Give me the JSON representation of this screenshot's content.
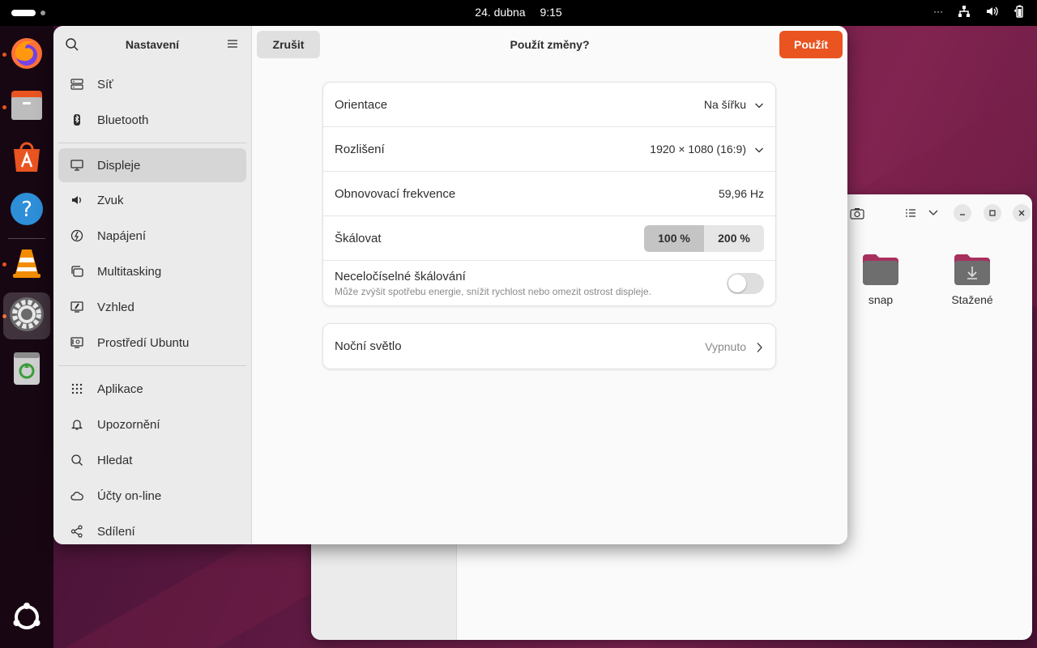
{
  "topbar": {
    "date": "24. dubna",
    "time": "9:15",
    "overflow": "···"
  },
  "dock": {
    "items": [
      "firefox-icon",
      "files-icon",
      "app-center-icon",
      "help-icon",
      "vlc-icon",
      "settings-icon",
      "trash-icon",
      "ubuntu-logo-icon"
    ]
  },
  "files": {
    "folders": [
      {
        "label": "snap"
      },
      {
        "label": "Stažené"
      }
    ]
  },
  "settings": {
    "sidebar": {
      "title": "Nastavení",
      "items": [
        {
          "label": "Síť",
          "icon": "network-icon"
        },
        {
          "label": "Bluetooth",
          "icon": "bluetooth-icon"
        },
        {
          "label": "Displeje",
          "icon": "display-icon"
        },
        {
          "label": "Zvuk",
          "icon": "sound-icon"
        },
        {
          "label": "Napájení",
          "icon": "power-icon"
        },
        {
          "label": "Multitasking",
          "icon": "multitasking-icon"
        },
        {
          "label": "Vzhled",
          "icon": "appearance-icon"
        },
        {
          "label": "Prostředí Ubuntu",
          "icon": "ubuntu-desktop-icon"
        },
        {
          "label": "Aplikace",
          "icon": "apps-icon"
        },
        {
          "label": "Upozornění",
          "icon": "notifications-icon"
        },
        {
          "label": "Hledat",
          "icon": "search-icon"
        },
        {
          "label": "Účty on-line",
          "icon": "cloud-icon"
        },
        {
          "label": "Sdílení",
          "icon": "share-icon"
        }
      ]
    },
    "header": {
      "cancel": "Zrušit",
      "title": "Použít změny?",
      "apply": "Použít"
    },
    "display": {
      "orientation_label": "Orientace",
      "orientation_value": "Na šířku",
      "resolution_label": "Rozlišení",
      "resolution_value": "1920 × 1080 (16:9)",
      "refresh_label": "Obnovovací frekvence",
      "refresh_value": "59,96 Hz",
      "scale_label": "Škálovat",
      "scale_options": [
        "100 %",
        "200 %"
      ],
      "fractional_label": "Neceločíselné škálování",
      "fractional_sub": "Může zvýšit spotřebu energie, snížit rychlost nebo omezit ostrost displeje.",
      "fractional_enabled": false,
      "night_label": "Noční světlo",
      "night_value": "Vypnuto"
    },
    "accent": "#e95420"
  }
}
